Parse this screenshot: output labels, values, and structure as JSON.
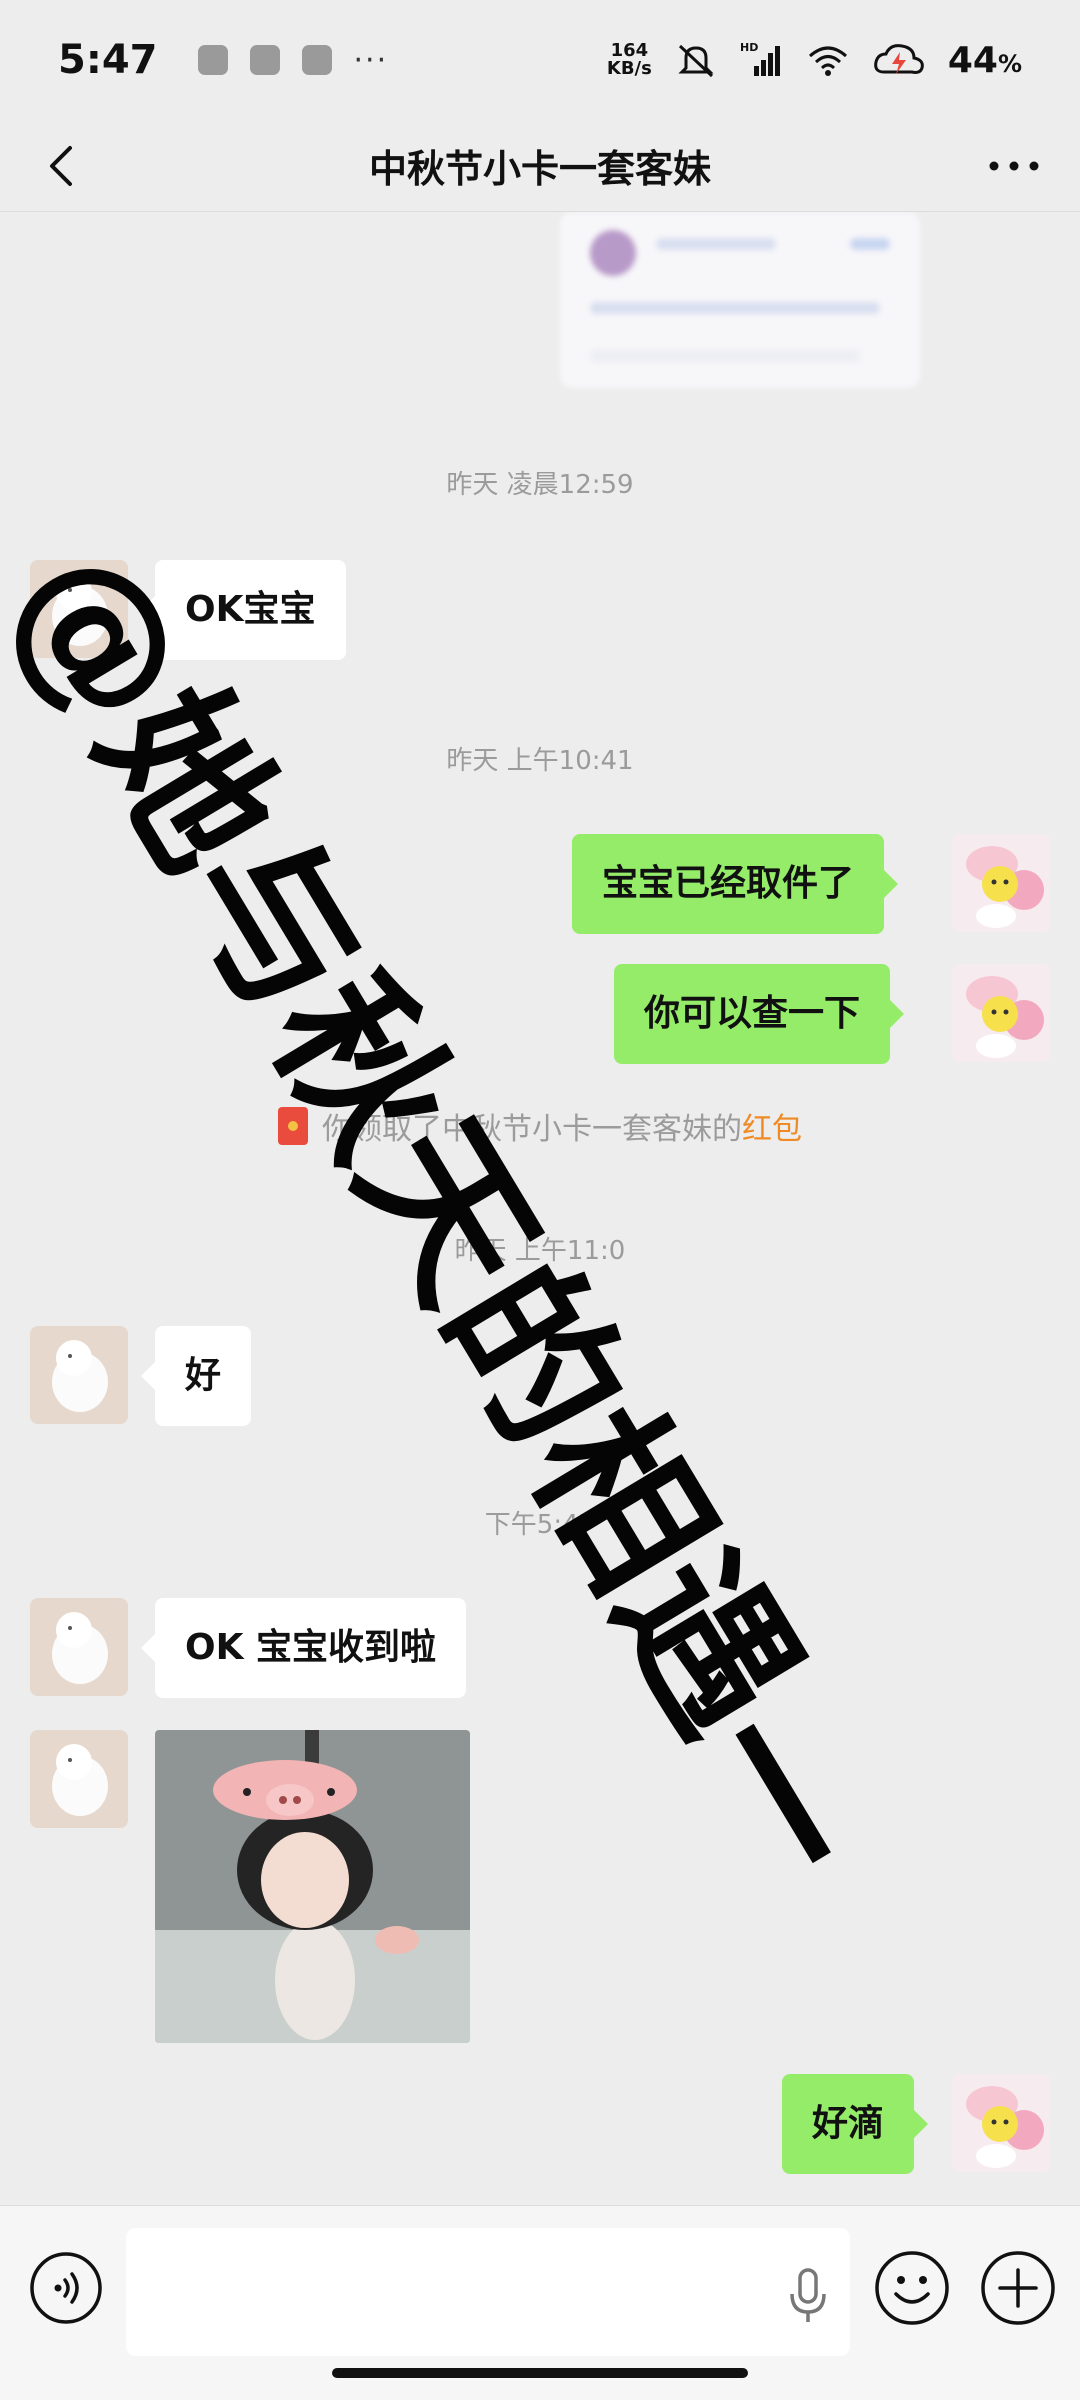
{
  "status_bar": {
    "time": "5:47",
    "more": "···",
    "net_speed_value": "164",
    "net_speed_unit": "KB/s",
    "hd": "HD",
    "battery": "44",
    "battery_unit": "%"
  },
  "header": {
    "title": "中秋节小卡一套客妹"
  },
  "messages": {
    "ts1": "昨天 凌晨12:59",
    "m1": "OK宝宝",
    "ts2": "昨天 上午10:41",
    "m2": "宝宝已经取件了",
    "m3": "你可以查一下",
    "notice_prefix": "你领取了中秋节小卡一套客妹的",
    "notice_link": "红包",
    "ts3": "昨天 上午11:0",
    "m4": "好",
    "ts4": "下午5:47",
    "m5": "OK 宝宝收到啦",
    "m6": "好滴"
  },
  "watermark": {
    "text": "@她与秋天的相遇—"
  },
  "input_bar": {
    "value": "",
    "placeholder": ""
  },
  "colors": {
    "background": "#ededed",
    "outgoing_bubble": "#95ec69",
    "incoming_bubble": "#ffffff",
    "timestamp": "#9b9b9b",
    "notice_link": "#f08a24"
  },
  "icons": [
    "back-icon",
    "more-dots-icon",
    "voice-icon",
    "mic-icon",
    "emoji-icon",
    "plus-icon",
    "red-envelope-icon"
  ]
}
